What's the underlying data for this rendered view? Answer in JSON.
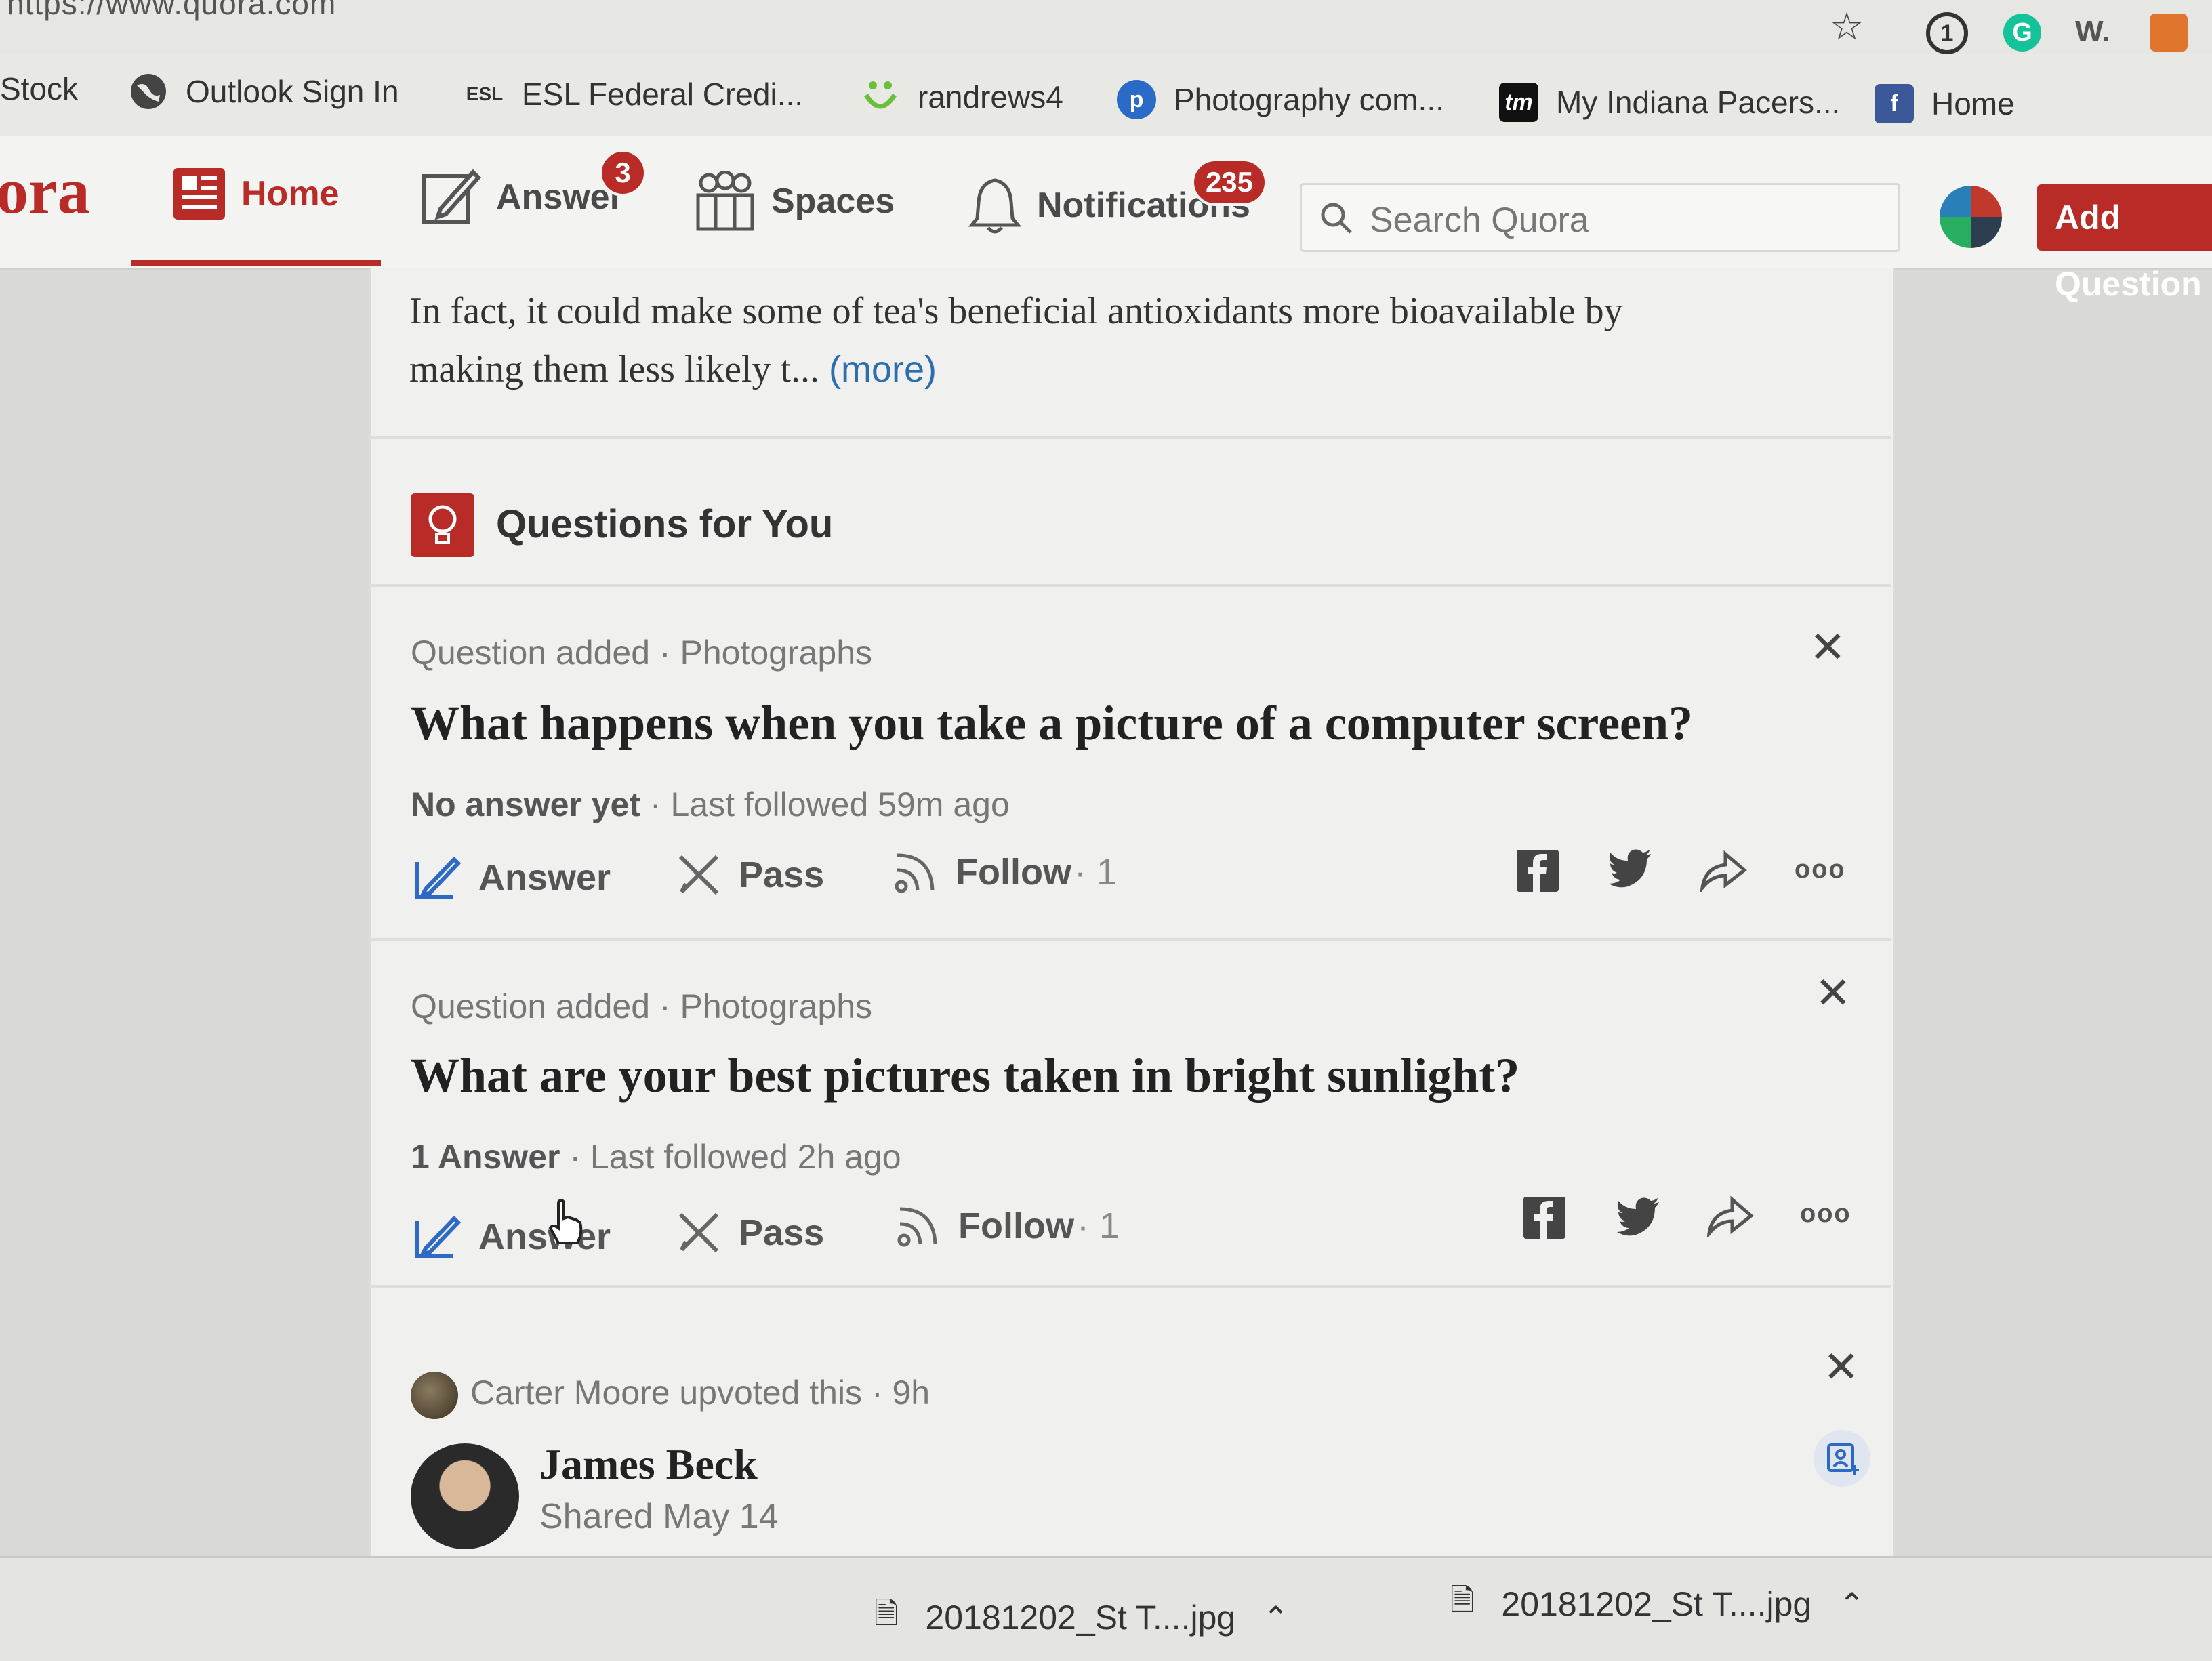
{
  "browser": {
    "url": "https://www.quora.com",
    "toolbar_icons": [
      "star-icon",
      "1password-icon",
      "grammarly-icon",
      "w-extension-icon",
      "orange-extension-icon"
    ],
    "extension_w_label": "W.",
    "bookmarks": [
      {
        "label": "Stock",
        "icon": ""
      },
      {
        "label": "Outlook Sign In",
        "icon": "globe-icon"
      },
      {
        "label": "ESL Federal Credi...",
        "icon": "esl-icon",
        "icon_text": "ESL"
      },
      {
        "label": "randrews4",
        "icon": "smile-icon"
      },
      {
        "label": "Photography com...",
        "icon": "photography-icon"
      },
      {
        "label": "My Indiana Pacers...",
        "icon": "tm-icon",
        "icon_text": "tm"
      },
      {
        "label": "Home",
        "icon": "facebook-icon",
        "icon_text": "f"
      }
    ]
  },
  "header": {
    "logo_partial": "ora",
    "nav": {
      "home": "Home",
      "answer": "Answer",
      "answer_badge": "3",
      "spaces": "Spaces",
      "notifications": "Notifications",
      "notifications_badge": "235"
    },
    "search_placeholder": "Search Quora",
    "add_question": "Add Question"
  },
  "feed": {
    "snippet": {
      "line1": "In fact, it could make some of tea's beneficial antioxidants more bioavailable by",
      "line2": "making them less likely t...",
      "more": "(more)"
    },
    "section_title": "Questions for You",
    "questions": [
      {
        "meta": "Question added · Photographs",
        "title": "What happens when you take a picture of a computer screen?",
        "status_bold": "No answer yet",
        "status_rest": " · Last followed 59m ago",
        "answer": "Answer",
        "pass": "Pass",
        "follow": "Follow",
        "follow_count": " · 1"
      },
      {
        "meta": "Question added · Photographs",
        "title": "What are your best pictures taken in bright sunlight?",
        "status_bold": "1 Answer",
        "status_rest": " · Last followed 2h ago",
        "answer": "Answer",
        "pass": "Pass",
        "follow": "Follow",
        "follow_count": " · 1"
      }
    ],
    "upvote_card": {
      "upvoter_line": "Carter Moore upvoted this · 9h",
      "author": "James Beck",
      "shared": "Shared May 14"
    }
  },
  "downloads": [
    {
      "name": "20181202_St T....jpg"
    },
    {
      "name": "20181202_St T....jpg"
    }
  ],
  "colors": {
    "quora_red": "#b92b27",
    "link_blue": "#2b6dad",
    "answer_icon_blue": "#2e69c4"
  }
}
